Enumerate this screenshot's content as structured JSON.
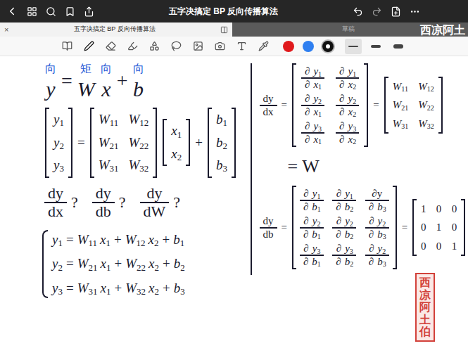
{
  "topbar": {
    "title": "五字决搞定 BP 反向传播算法"
  },
  "tabs": [
    {
      "label": "五字决搞定 BP 反向传播算法",
      "selected": true,
      "close": "×"
    },
    {
      "label": "草稿",
      "selected": false
    }
  ],
  "watermark": "西凉阿土",
  "toolbar": {
    "colors": [
      {
        "color": "#e0191c",
        "selected": false
      },
      {
        "color": "#2f7ff0",
        "selected": false
      },
      {
        "color": "#111111",
        "selected": true
      }
    ],
    "widths": [
      {
        "level": 0.25,
        "selected": true
      },
      {
        "level": 0.5,
        "selected": false
      },
      {
        "level": 0.8,
        "selected": false
      }
    ]
  },
  "left": {
    "equation": [
      {
        "t": "y",
        "note": "向"
      },
      "=",
      {
        "t": "W",
        "note": "矩"
      },
      {
        "t": "x",
        "note": "向"
      },
      "+",
      {
        "t": "b",
        "note": "向"
      }
    ],
    "matrix_equation": [
      {
        "matrix": [
          [
            [
              {
                "b": "y",
                "s": "1"
              }
            ]
          ],
          [
            [
              {
                "b": "y",
                "s": "2"
              }
            ]
          ],
          [
            [
              {
                "b": "y",
                "s": "3"
              }
            ]
          ]
        ]
      },
      "=",
      {
        "matrix": [
          [
            [
              {
                "b": "W",
                "s": "11"
              }
            ],
            [
              {
                "b": "W",
                "s": "12"
              }
            ]
          ],
          [
            [
              {
                "b": "W",
                "s": "21"
              }
            ],
            [
              {
                "b": "W",
                "s": "22"
              }
            ]
          ],
          [
            [
              {
                "b": "W",
                "s": "31"
              }
            ],
            [
              {
                "b": "W",
                "s": "32"
              }
            ]
          ]
        ]
      },
      {
        "matrix": [
          [
            [
              {
                "b": "x",
                "s": "1"
              }
            ]
          ],
          [
            [
              {
                "b": "x",
                "s": "2"
              }
            ]
          ]
        ]
      },
      "+",
      {
        "matrix": [
          [
            [
              {
                "b": "b",
                "s": "1"
              }
            ]
          ],
          [
            [
              {
                "b": "b",
                "s": "2"
              }
            ]
          ],
          [
            [
              {
                "b": "b",
                "s": "3"
              }
            ]
          ]
        ]
      }
    ],
    "questions": [
      [
        {
          "num": [
            "dy"
          ],
          "den": [
            "dx"
          ]
        },
        "?"
      ],
      [
        {
          "num": [
            "dy"
          ],
          "den": [
            "db"
          ]
        },
        "?"
      ],
      [
        {
          "num": [
            "dy"
          ],
          "den": [
            "dW"
          ]
        },
        "?"
      ]
    ],
    "system": [
      [
        {
          "b": "y",
          "s": "1"
        },
        "=",
        {
          "b": "W",
          "s": "11"
        },
        {
          "b": "x",
          "s": "1"
        },
        "+",
        {
          "b": "W",
          "s": "12"
        },
        {
          "b": "x",
          "s": "2"
        },
        "+",
        {
          "b": "b",
          "s": "1"
        }
      ],
      [
        {
          "b": "y",
          "s": "2"
        },
        "=",
        {
          "b": "W",
          "s": "21"
        },
        {
          "b": "x",
          "s": "1"
        },
        "+",
        {
          "b": "W",
          "s": "22"
        },
        {
          "b": "x",
          "s": "2"
        },
        "+",
        {
          "b": "b",
          "s": "2"
        }
      ],
      [
        {
          "b": "y",
          "s": "3"
        },
        "=",
        {
          "b": "W",
          "s": "31"
        },
        {
          "b": "x",
          "s": "1"
        },
        "+",
        {
          "b": "W",
          "s": "32"
        },
        {
          "b": "x",
          "s": "2"
        },
        "+",
        {
          "b": "b",
          "s": "3"
        }
      ]
    ]
  },
  "right": {
    "dydx": [
      {
        "num": [
          "dy"
        ],
        "den": [
          "dx"
        ]
      },
      "=",
      {
        "matrix": [
          [
            [
              {
                "num": [
                  "∂",
                  {
                    "b": "y",
                    "s": "1"
                  }
                ],
                "den": [
                  "∂",
                  {
                    "b": "x",
                    "s": "1"
                  }
                ]
              }
            ],
            [
              {
                "num": [
                  "∂",
                  {
                    "b": "y",
                    "s": "1"
                  }
                ],
                "den": [
                  "∂",
                  {
                    "b": "x",
                    "s": "2"
                  }
                ]
              }
            ]
          ],
          [
            [
              {
                "num": [
                  "∂",
                  {
                    "b": "y",
                    "s": "2"
                  }
                ],
                "den": [
                  "∂",
                  {
                    "b": "x",
                    "s": "1"
                  }
                ]
              }
            ],
            [
              {
                "num": [
                  "∂",
                  {
                    "b": "y",
                    "s": "2"
                  }
                ],
                "den": [
                  "∂",
                  {
                    "b": "x",
                    "s": "2"
                  }
                ]
              }
            ]
          ],
          [
            [
              {
                "num": [
                  "∂",
                  {
                    "b": "y",
                    "s": "3"
                  }
                ],
                "den": [
                  "∂",
                  {
                    "b": "x",
                    "s": "1"
                  }
                ]
              }
            ],
            [
              {
                "num": [
                  "∂",
                  {
                    "b": "y",
                    "s": "3"
                  }
                ],
                "den": [
                  "∂",
                  {
                    "b": "x",
                    "s": "2"
                  }
                ]
              }
            ]
          ]
        ]
      },
      "=",
      {
        "matrix": [
          [
            [
              {
                "b": "W",
                "s": "11"
              }
            ],
            [
              {
                "b": "W",
                "s": "12"
              }
            ]
          ],
          [
            [
              {
                "b": "W",
                "s": "21"
              }
            ],
            [
              {
                "b": "W",
                "s": "22"
              }
            ]
          ],
          [
            [
              {
                "b": "W",
                "s": "31"
              }
            ],
            [
              {
                "b": "W",
                "s": "32"
              }
            ]
          ]
        ]
      }
    ],
    "equals_w": [
      "=",
      "W"
    ],
    "dydb": [
      {
        "num": [
          "dy"
        ],
        "den": [
          "db"
        ]
      },
      "=",
      {
        "matrix": [
          [
            [
              {
                "num": [
                  "∂",
                  {
                    "b": "y",
                    "s": "1"
                  }
                ],
                "den": [
                  "∂",
                  {
                    "b": "b",
                    "s": "1"
                  }
                ]
              }
            ],
            [
              {
                "num": [
                  "∂",
                  {
                    "b": "y",
                    "s": "1"
                  }
                ],
                "den": [
                  "∂",
                  {
                    "b": "b",
                    "s": "2"
                  }
                ]
              }
            ],
            [
              {
                "num": [
                  "∂y"
                ],
                "den": [
                  "∂",
                  {
                    "b": "b",
                    "s": "3"
                  }
                ]
              }
            ]
          ],
          [
            [
              {
                "num": [
                  "∂",
                  {
                    "b": "y",
                    "s": "2"
                  }
                ],
                "den": [
                  "∂",
                  {
                    "b": "b",
                    "s": "1"
                  }
                ]
              }
            ],
            [
              {
                "num": [
                  "∂",
                  {
                    "b": "y",
                    "s": "2"
                  }
                ],
                "den": [
                  "∂",
                  {
                    "b": "b",
                    "s": "2"
                  }
                ]
              }
            ],
            [
              {
                "num": [
                  "∂",
                  {
                    "b": "y",
                    "s": "2"
                  }
                ],
                "den": [
                  "∂",
                  {
                    "b": "b",
                    "s": "3"
                  }
                ]
              }
            ]
          ],
          [
            [
              {
                "num": [
                  "∂",
                  {
                    "b": "y",
                    "s": "3"
                  }
                ],
                "den": [
                  "∂",
                  {
                    "b": "b",
                    "s": "1"
                  }
                ]
              }
            ],
            [
              {
                "num": [
                  "∂",
                  {
                    "b": "y",
                    "s": "3"
                  }
                ],
                "den": [
                  "∂",
                  {
                    "b": "b",
                    "s": "2"
                  }
                ]
              }
            ],
            [
              {
                "num": [
                  "∂",
                  {
                    "b": "y",
                    "s": "2"
                  }
                ],
                "den": [
                  "∂",
                  {
                    "b": "b",
                    "s": "3"
                  }
                ]
              }
            ]
          ]
        ]
      },
      "=",
      {
        "matrix": [
          [
            [
              "1"
            ],
            [
              "0"
            ],
            [
              "0"
            ]
          ],
          [
            [
              "0"
            ],
            [
              "1"
            ],
            [
              "0"
            ]
          ],
          [
            [
              "0"
            ],
            [
              "0"
            ],
            [
              "1"
            ]
          ]
        ]
      }
    ]
  },
  "stamp": "西凉阿土伯"
}
